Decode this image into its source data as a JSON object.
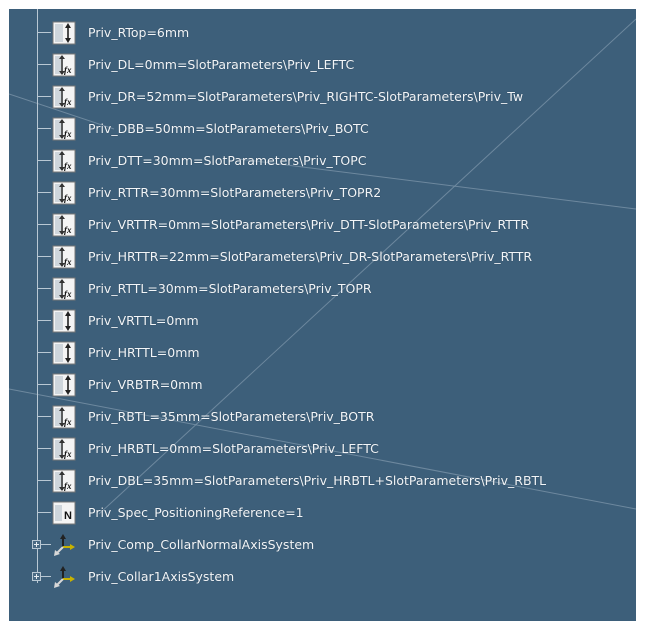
{
  "tree": {
    "rows": [
      {
        "label": "Priv_RTop=6mm",
        "icon": "length-parameter-icon"
      },
      {
        "label": "Priv_DL=0mm=SlotParameters\\Priv_LEFTC",
        "icon": "formula-parameter-icon"
      },
      {
        "label": "Priv_DR=52mm=SlotParameters\\Priv_RIGHTC-SlotParameters\\Priv_Tw",
        "icon": "formula-parameter-icon"
      },
      {
        "label": "Priv_DBB=50mm=SlotParameters\\Priv_BOTC",
        "icon": "formula-parameter-icon"
      },
      {
        "label": "Priv_DTT=30mm=SlotParameters\\Priv_TOPC",
        "icon": "formula-parameter-icon"
      },
      {
        "label": "Priv_RTTR=30mm=SlotParameters\\Priv_TOPR2",
        "icon": "formula-parameter-icon"
      },
      {
        "label": "Priv_VRTTR=0mm=SlotParameters\\Priv_DTT-SlotParameters\\Priv_RTTR",
        "icon": "formula-parameter-icon"
      },
      {
        "label": "Priv_HRTTR=22mm=SlotParameters\\Priv_DR-SlotParameters\\Priv_RTTR",
        "icon": "formula-parameter-icon"
      },
      {
        "label": "Priv_RTTL=30mm=SlotParameters\\Priv_TOPR",
        "icon": "formula-parameter-icon"
      },
      {
        "label": "Priv_VRTTL=0mm",
        "icon": "length-parameter-icon"
      },
      {
        "label": "Priv_HRTTL=0mm",
        "icon": "length-parameter-icon"
      },
      {
        "label": "Priv_VRBTR=0mm",
        "icon": "length-parameter-icon"
      },
      {
        "label": "Priv_RBTL=35mm=SlotParameters\\Priv_BOTR",
        "icon": "formula-parameter-icon"
      },
      {
        "label": "Priv_HRBTL=0mm=SlotParameters\\Priv_LEFTC",
        "icon": "formula-parameter-icon"
      },
      {
        "label": "Priv_DBL=35mm=SlotParameters\\Priv_HRBTL+SlotParameters\\Priv_RBTL",
        "icon": "formula-parameter-icon"
      },
      {
        "label": "Priv_Spec_PositioningReference=1",
        "icon": "integer-parameter-icon"
      },
      {
        "label": "Priv_Comp_CollarNormalAxisSystem",
        "icon": "axis-system-icon",
        "expandable": true
      },
      {
        "label": "Priv_Collar1AxisSystem",
        "icon": "axis-system-icon",
        "expandable": true
      }
    ]
  },
  "colors": {
    "background": "#3d5f7a",
    "text": "#f2f5f8"
  }
}
